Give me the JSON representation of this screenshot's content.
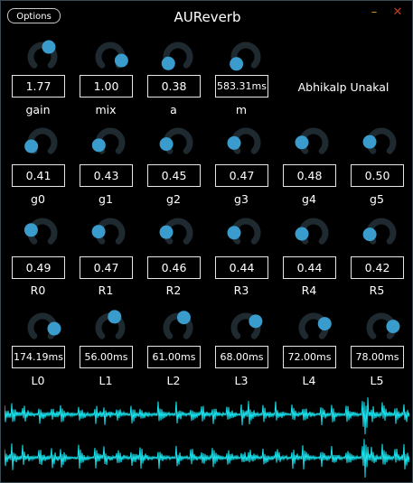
{
  "window": {
    "title": "AUReverb",
    "options_label": "Options",
    "minimize_glyph": "–",
    "close_glyph": "✕",
    "author": "Abhikalp Unakal"
  },
  "colors": {
    "background": "#000000",
    "knob_track": "#1f2a30",
    "knob_thumb": "#3a9ccc",
    "waveform": "#18e5f0",
    "minimize": "#d99a1f",
    "close": "#c0392b"
  },
  "rows": [
    [
      {
        "label": "gain",
        "value": "1.77",
        "position": 0.62
      },
      {
        "label": "mix",
        "value": "1.00",
        "position": 0.9
      },
      {
        "label": "a",
        "value": "0.38",
        "position": 0.04
      },
      {
        "label": "m",
        "value": "583.31ms",
        "position": 0.03
      }
    ],
    [
      {
        "label": "g0",
        "value": "0.41",
        "position": 0.1
      },
      {
        "label": "g1",
        "value": "0.43",
        "position": 0.12
      },
      {
        "label": "g2",
        "value": "0.45",
        "position": 0.14
      },
      {
        "label": "g3",
        "value": "0.47",
        "position": 0.16
      },
      {
        "label": "g4",
        "value": "0.48",
        "position": 0.17
      },
      {
        "label": "g5",
        "value": "0.50",
        "position": 0.18
      }
    ],
    [
      {
        "label": "R0",
        "value": "0.49",
        "position": 0.22
      },
      {
        "label": "R1",
        "value": "0.47",
        "position": 0.19
      },
      {
        "label": "R2",
        "value": "0.46",
        "position": 0.18
      },
      {
        "label": "R3",
        "value": "0.44",
        "position": 0.17
      },
      {
        "label": "R4",
        "value": "0.44",
        "position": 0.15
      },
      {
        "label": "R5",
        "value": "0.42",
        "position": 0.14
      }
    ],
    [
      {
        "label": "L0",
        "value": "174.19ms",
        "position": 0.85
      },
      {
        "label": "L1",
        "value": "56.00ms",
        "position": 0.58
      },
      {
        "label": "L2",
        "value": "61.00ms",
        "position": 0.61
      },
      {
        "label": "L3",
        "value": "68.00ms",
        "position": 0.71
      },
      {
        "label": "L4",
        "value": "72.00ms",
        "position": 0.76
      },
      {
        "label": "L5",
        "value": "78.00ms",
        "position": 0.81
      }
    ]
  ]
}
